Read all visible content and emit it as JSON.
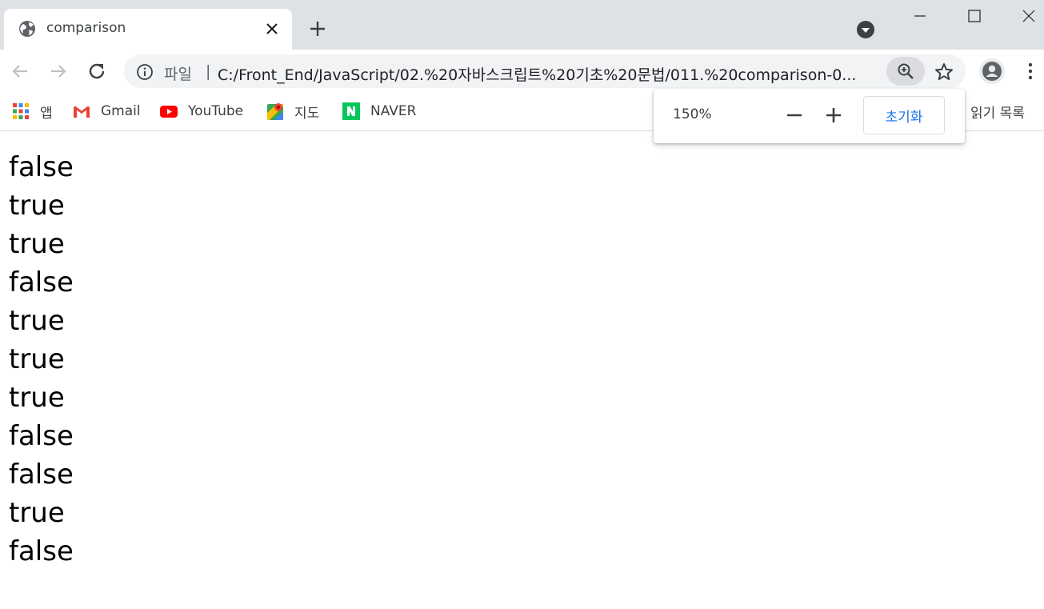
{
  "tab": {
    "title": "comparison"
  },
  "address_bar": {
    "scheme_label": "파일",
    "separator": "|",
    "url": "C:/Front_End/JavaScript/02.%20자바스크립트%20기초%20문법/011.%20comparison-0..."
  },
  "bookmarks": {
    "apps": "앱",
    "gmail": "Gmail",
    "youtube": "YouTube",
    "maps": "지도",
    "naver": "NAVER",
    "reading_list": "읽기 목록"
  },
  "zoom_popup": {
    "level": "150%",
    "reset_label": "초기화"
  },
  "output_lines": [
    "false",
    "true",
    "true",
    "false",
    "true",
    "true",
    "true",
    "false",
    "false",
    "true",
    "false"
  ],
  "colors": {
    "tabstrip": "#dee1e6",
    "accent": "#1a73e8",
    "youtube": "#ff0000",
    "naver": "#03c75a"
  }
}
